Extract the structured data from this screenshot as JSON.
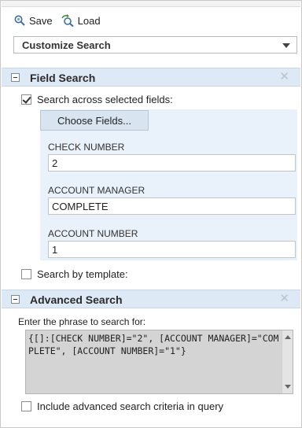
{
  "toolbar": {
    "save_label": "Save",
    "load_label": "Load"
  },
  "customize_select": {
    "selected": "Customize Search"
  },
  "field_search": {
    "title": "Field Search",
    "close_glyph": "✕",
    "across_fields_label": "Search across selected fields:",
    "across_fields_checked": true,
    "choose_fields_label": "Choose Fields...",
    "fields": [
      {
        "label": "CHECK NUMBER",
        "value": "2"
      },
      {
        "label": "ACCOUNT MANAGER",
        "value": "COMPLETE"
      },
      {
        "label": "ACCOUNT NUMBER",
        "value": "1"
      }
    ],
    "by_template_label": "Search by template:",
    "by_template_checked": false
  },
  "advanced_search": {
    "title": "Advanced Search",
    "close_glyph": "✕",
    "phrase_label": "Enter the phrase to search for:",
    "phrase_value": "{[]:[CHECK NUMBER]=\"2\", [ACCOUNT MANAGER]=\"COMPLETE\", [ACCOUNT NUMBER]=\"1\"}",
    "include_label": "Include advanced search criteria in query",
    "include_checked": false
  },
  "colors": {
    "section_header_bg": "#dde9f4",
    "fields_panel_bg": "#e9f1fa",
    "button_bg": "#d8e4f0",
    "textarea_bg": "#d4d4d4"
  }
}
